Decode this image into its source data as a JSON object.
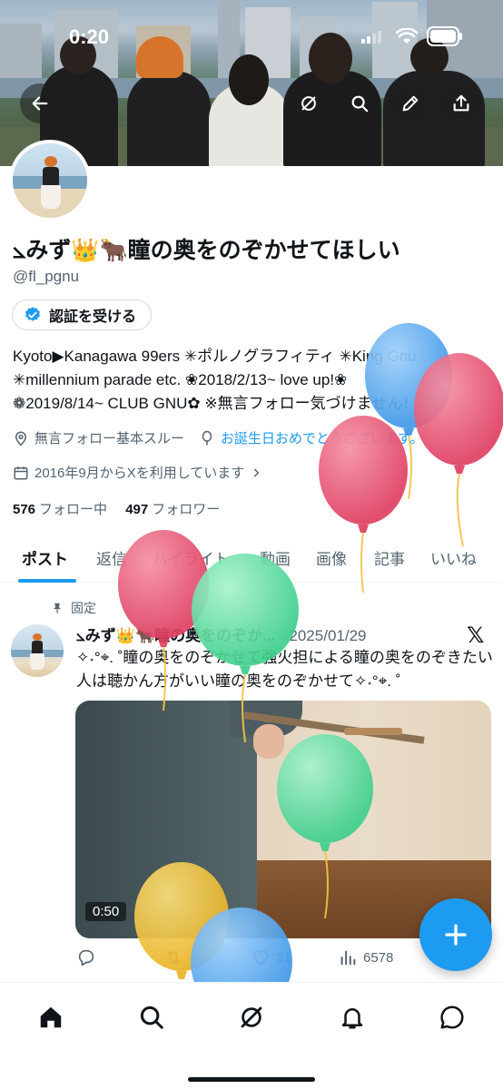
{
  "status_bar": {
    "time": "0:20"
  },
  "profile": {
    "display_name": "⦣みず👑🐂瞳の奥をのぞかせてほしい",
    "handle": "@fl_pgnu",
    "verify_button_label": "認証を受ける",
    "bio_lines": [
      "Kyoto▶Kanagawa 99ers ✳︎ポルノグラフィティ ✳︎King Gnu",
      "✳︎millennium parade  etc. ❀2018/2/13~ love up!❀",
      "❁2019/8/14~ CLUB GNU✿ ※無言フォロー気づけません！"
    ],
    "location": "無言フォロー基本スルー",
    "birthday_link": "お誕生日おめでとうございます。",
    "joined": "2016年9月からXを利用しています",
    "following_count": "576",
    "following_label": "フォロー中",
    "followers_count": "497",
    "followers_label": "フォロワー"
  },
  "tabs": [
    {
      "label": "ポスト",
      "active": true
    },
    {
      "label": "返信",
      "active": false
    },
    {
      "label": "ハイライト",
      "active": false
    },
    {
      "label": "動画",
      "active": false
    },
    {
      "label": "画像",
      "active": false
    },
    {
      "label": "記事",
      "active": false
    },
    {
      "label": "いいね",
      "active": false
    }
  ],
  "pinned_tweet": {
    "pinned_label": "固定",
    "author_name": "⦣みず👑🐂瞳の奥をのぞか...",
    "date": "· 2025/01/29",
    "text": "✧˖°⌖. ˚瞳の奥をのぞかせて強火担による瞳の奥をのぞきたい人は聴かん方がいい瞳の奥をのぞかせて✧˖°⌖. ˚",
    "video_duration": "0:50",
    "likes": "21",
    "views": "6578"
  },
  "icons": {
    "back": "arrow-left-icon",
    "grok": "grok-icon",
    "search": "search-icon",
    "edit": "pencil-icon",
    "share": "share-icon",
    "verified": "verified-badge-icon",
    "location": "location-pin-icon",
    "balloon": "balloon-icon",
    "calendar": "calendar-icon",
    "pin": "pin-icon",
    "x_logo": "x-logo-icon",
    "reply": "reply-icon",
    "repost": "repost-icon",
    "like": "heart-icon",
    "views": "views-icon",
    "compose": "plus-icon",
    "nav_home": "home-icon",
    "nav_search": "search-icon",
    "nav_grok": "grok-icon",
    "nav_notifications": "bell-icon",
    "nav_messages": "message-icon"
  },
  "x_logo_text": "𝕏",
  "colors": {
    "accent": "#1d9bf0",
    "text": "#0f1419",
    "muted": "#536471"
  }
}
